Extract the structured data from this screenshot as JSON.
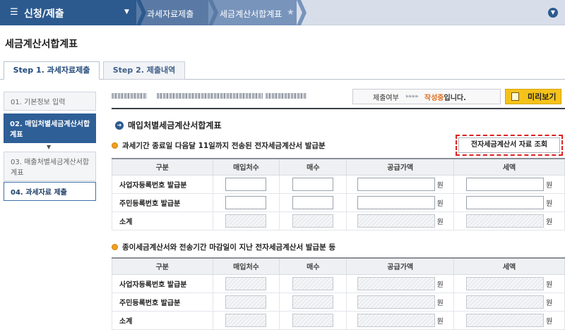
{
  "topbar": {
    "menu_title": "신청/제출",
    "breadcrumbs": [
      "과세자료제출",
      "세금계산서합계표"
    ],
    "icons": {
      "menu": "hamburger-icon",
      "caret": "caret-down-icon",
      "favorite": "star-icon",
      "expand": "chevron-down-icon"
    }
  },
  "page_title": "세금계산서합계표",
  "tabs": [
    {
      "label": "Step 1. 과세자료제출",
      "active": true
    },
    {
      "label": "Step 2. 제출내역",
      "active": false
    }
  ],
  "steps": [
    {
      "label": "01. 기본정보 입력",
      "active": false
    },
    {
      "label": "02. 매입처별세금계산서합계표",
      "active": true
    },
    {
      "label": "03. 매출처별세금계산서합계표",
      "active": false
    },
    {
      "label": "04. 과세자료 제출",
      "active": false
    }
  ],
  "status": {
    "label": "제출여부",
    "arrows": "▸▸▸▸",
    "value": "작성중",
    "suffix": "입니다.",
    "preview_label": "미리보기"
  },
  "section_title": "매입처별세금계산서합계표",
  "subsection1": {
    "title": "과세기간 종료일 다음달 11일까지 전송된 전자세금계산서 발급분",
    "lookup_label": "전자세금계산서 자료 조회"
  },
  "subsection2": {
    "title": "종이세금계산서와 전송기간 마감일이 지난 전자세금계산서 발급분 등"
  },
  "table_headers": [
    "구분",
    "매입처수",
    "매수",
    "공급가액",
    "세액"
  ],
  "table_rows": [
    "사업자등록번호 발급분",
    "주민등록번호 발급분",
    "소계"
  ],
  "unit": "원",
  "colors": {
    "brand": "#2c5a8e",
    "accent": "#e0701e",
    "preview": "#f5c21a",
    "highlight": "#e02020"
  }
}
